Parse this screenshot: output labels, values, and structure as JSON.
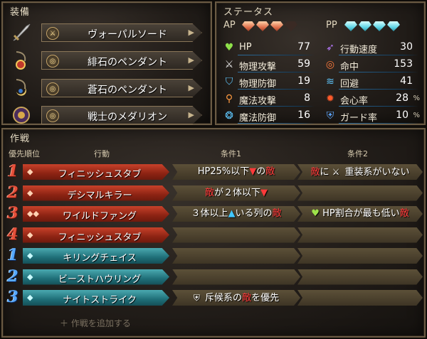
{
  "equipment": {
    "title": "装備",
    "items": [
      {
        "name": "ヴォーパルソード",
        "icon": "sword-icon",
        "type_glyph": "⚔"
      },
      {
        "name": "緋石のペンダント",
        "icon": "red-pendant-icon",
        "type_glyph": "◎"
      },
      {
        "name": "蒼石のペンダント",
        "icon": "blue-pendant-icon",
        "type_glyph": "◎"
      },
      {
        "name": "戦士のメダリオン",
        "icon": "medallion-icon",
        "type_glyph": "◎"
      }
    ]
  },
  "status": {
    "title": "ステータス",
    "ap": {
      "label": "AP",
      "filled": 3,
      "max": 4,
      "color": "#e0704c"
    },
    "pp": {
      "label": "PP",
      "filled": 4,
      "max": 4,
      "color": "#5fd6e6"
    },
    "left": [
      {
        "label": "HP",
        "value": "77",
        "icon": "heart-icon",
        "unit": ""
      },
      {
        "label": "物理攻撃",
        "value": "59",
        "icon": "sword-attack-icon",
        "unit": ""
      },
      {
        "label": "物理防御",
        "value": "19",
        "icon": "armor-icon",
        "unit": ""
      },
      {
        "label": "魔法攻撃",
        "value": "8",
        "icon": "wand-icon",
        "unit": ""
      },
      {
        "label": "魔法防御",
        "value": "16",
        "icon": "magic-defense-icon",
        "unit": ""
      }
    ],
    "right": [
      {
        "label": "行動速度",
        "value": "30",
        "icon": "speed-icon",
        "unit": ""
      },
      {
        "label": "命中",
        "value": "153",
        "icon": "target-icon",
        "unit": ""
      },
      {
        "label": "回避",
        "value": "41",
        "icon": "evasion-icon",
        "unit": ""
      },
      {
        "label": "会心率",
        "value": "28",
        "icon": "critical-icon",
        "unit": "%"
      },
      {
        "label": "ガード率",
        "value": "10",
        "icon": "shield-icon",
        "unit": "%"
      }
    ]
  },
  "tactics": {
    "title": "作戦",
    "headers": {
      "priority": "優先順位",
      "action": "行動",
      "cond1": "条件1",
      "cond2": "条件2"
    },
    "rows": [
      {
        "num": "1",
        "color": "red",
        "skill": "フィニッシュスタブ",
        "cost": "◆",
        "c1": [
          {
            "t": "HP25%以下"
          },
          {
            "t": "▼",
            "c": "hl"
          },
          {
            "t": "の"
          },
          {
            "t": "敵",
            "c": "hl"
          }
        ],
        "c2": [
          {
            "t": "敵",
            "c": "hl"
          },
          {
            "t": "に "
          },
          {
            "t": "⚔",
            "c": "ic"
          },
          {
            "t": " 重装系がいない"
          }
        ]
      },
      {
        "num": "2",
        "color": "red",
        "skill": "デシマルキラー",
        "cost": "◆",
        "c1": [
          {
            "t": "敵",
            "c": "hl"
          },
          {
            "t": "が２体以下"
          },
          {
            "t": "▼",
            "c": "hl"
          }
        ],
        "c2": []
      },
      {
        "num": "3",
        "color": "red",
        "skill": "ワイルドファング",
        "cost": "◆◆",
        "c1": [
          {
            "t": "３体以上"
          },
          {
            "t": "▲",
            "c": "up"
          },
          {
            "t": "いる列の"
          },
          {
            "t": "敵",
            "c": "hl"
          }
        ],
        "c2": [
          {
            "t": "♥",
            "c": "green"
          },
          {
            "t": " HP割合が最も低い"
          },
          {
            "t": "敵",
            "c": "hl"
          }
        ]
      },
      {
        "num": "4",
        "color": "red",
        "skill": "フィニッシュスタブ",
        "cost": "◆",
        "c1": [],
        "c2": []
      },
      {
        "num": "1",
        "color": "blue",
        "skill": "キリングチェイス",
        "cost": "◆",
        "c1": [],
        "c2": []
      },
      {
        "num": "2",
        "color": "blue",
        "skill": "ビーストハウリング",
        "cost": "◆",
        "c1": [],
        "c2": []
      },
      {
        "num": "3",
        "color": "blue",
        "skill": "ナイトストライク",
        "cost": "◆",
        "c1": [
          {
            "t": "⛨",
            "c": "ic"
          },
          {
            "t": " 斥候系の"
          },
          {
            "t": "敵",
            "c": "hl"
          },
          {
            "t": "を優先"
          }
        ],
        "c2": []
      }
    ],
    "add_label": "＋ 作戦を追加する"
  }
}
